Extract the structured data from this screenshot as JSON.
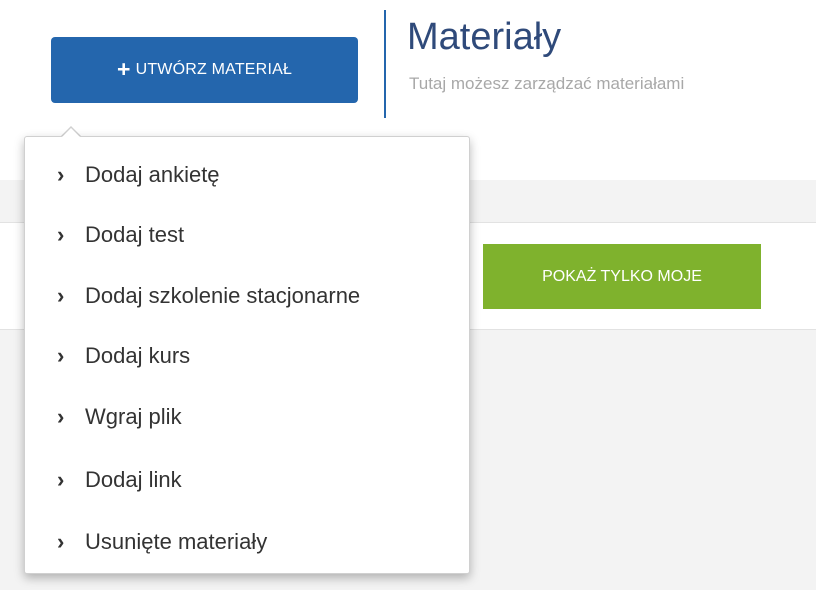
{
  "header": {
    "create_button_label": "UTWÓRZ MATERIAŁ",
    "create_button_icon": "plus-icon",
    "title": "Materiały",
    "subtitle": "Tutaj możesz zarządzać materiałami"
  },
  "toolbar": {
    "show_mine_label": "POKAŻ TYLKO MOJE"
  },
  "dropdown": {
    "item_icon": "chevron-right-icon",
    "items": [
      {
        "label": "Dodaj ankietę"
      },
      {
        "label": "Dodaj test"
      },
      {
        "label": "Dodaj szkolenie stacjonarne"
      },
      {
        "label": "Dodaj kurs"
      },
      {
        "label": "Wgraj plik"
      },
      {
        "label": "Dodaj link"
      },
      {
        "label": "Usunięte materiały"
      }
    ]
  },
  "colors": {
    "primary_blue": "#2466ad",
    "title_blue": "#2f4a7a",
    "green": "#7fb22d",
    "subtitle_gray": "#a8a8a8",
    "background_gray": "#f3f3f3"
  }
}
